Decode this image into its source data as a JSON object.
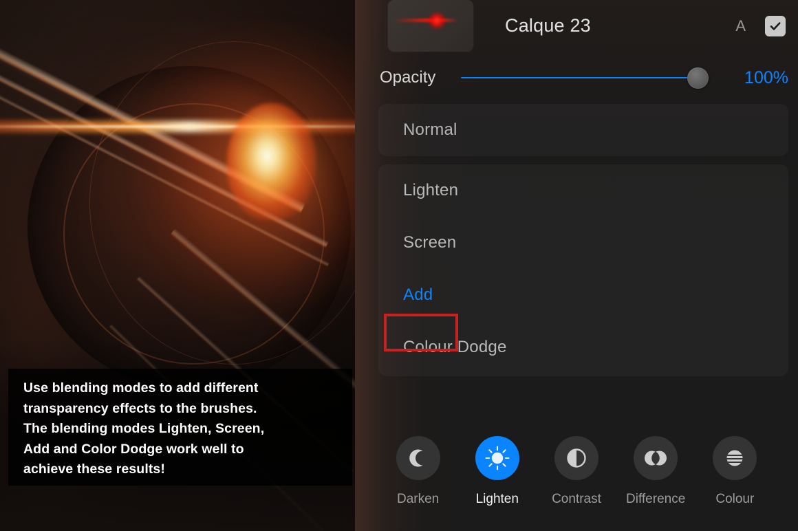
{
  "artwork": {
    "alt_description": "Dark metallic textured artwork with a bright orange-red glowing lens flare",
    "caption": "Use blending modes to add  different\ntransparency effects to the brushes.\nThe blending modes Lighten, Screen,\nAdd and Color Dodge work well to\nachieve these results!"
  },
  "panel": {
    "layer": {
      "thumbnail_name": "layer-thumbnail",
      "title": "Calque 23",
      "alpha_lock_label": "A",
      "visibility_checked": true,
      "check_icon": "checkmark-icon"
    },
    "opacity": {
      "label": "Opacity",
      "value": "100%",
      "percent": 100,
      "track_color": "#0a84ff",
      "value_color": "#0a84ff"
    },
    "current_mode": {
      "label": "Normal"
    },
    "mode_list": [
      {
        "label": "Lighten",
        "selected": false
      },
      {
        "label": "Screen",
        "selected": false
      },
      {
        "label": "Add",
        "selected": true
      },
      {
        "label": "Colour Dodge",
        "selected": false
      }
    ],
    "annotation": {
      "target": "Add",
      "color": "#c62320"
    },
    "categories": [
      {
        "label": "Darken",
        "icon": "moon-icon",
        "active": false
      },
      {
        "label": "Lighten",
        "icon": "sun-icon",
        "active": true
      },
      {
        "label": "Contrast",
        "icon": "half-circle-icon",
        "active": false
      },
      {
        "label": "Difference",
        "icon": "overlapping-circles-icon",
        "active": false
      },
      {
        "label": "Colour",
        "icon": "striped-circle-icon",
        "active": false
      }
    ],
    "accent_color": "#0a84ff"
  }
}
